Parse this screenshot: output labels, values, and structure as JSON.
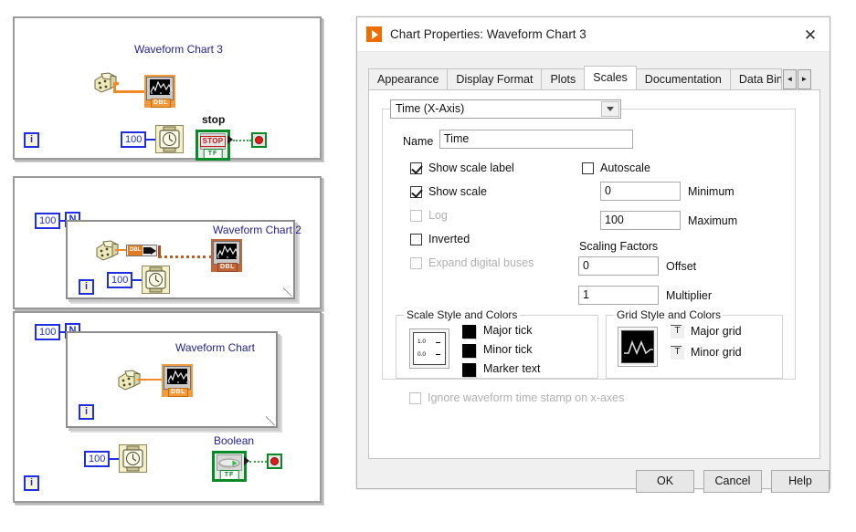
{
  "block_diagrams": {
    "panel1": {
      "chart_title": "Waveform Chart 3",
      "chart_type_label": "DBL",
      "wait_constant": "100",
      "iteration_terminal": "i",
      "stop_label": "stop",
      "stop_button_text": "STOP",
      "bool_tf": "TF"
    },
    "panel2": {
      "loop_count": "100",
      "count_terminal": "N",
      "chart_title": "Waveform Chart 2",
      "chart_type_label": "DBL",
      "wait_constant": "100",
      "iteration_terminal": "i"
    },
    "panel3": {
      "loop_count": "100",
      "count_terminal": "N",
      "chart_title": "Waveform Chart",
      "chart_type_label": "DBL",
      "iteration_terminal_inner": "i",
      "wait_constant": "100",
      "boolean_label": "Boolean",
      "bool_tf": "TF",
      "iteration_terminal_outer": "i"
    }
  },
  "dialog": {
    "title": "Chart Properties: Waveform Chart 3",
    "close_label": "✕",
    "tabs": [
      {
        "label": "Appearance",
        "active": false
      },
      {
        "label": "Display Format",
        "active": false
      },
      {
        "label": "Plots",
        "active": false
      },
      {
        "label": "Scales",
        "active": true
      },
      {
        "label": "Documentation",
        "active": false
      },
      {
        "label": "Data Bin",
        "active": false
      }
    ],
    "tab_nav": {
      "prev": "◄",
      "next": "►"
    },
    "scales": {
      "axis_selector_value": "Time (X-Axis)",
      "name_label": "Name",
      "name_value": "Time",
      "checkboxes": [
        {
          "label": "Show scale label",
          "checked": true,
          "disabled": false
        },
        {
          "label": "Show scale",
          "checked": true,
          "disabled": false
        },
        {
          "label": "Log",
          "checked": false,
          "disabled": true
        },
        {
          "label": "Inverted",
          "checked": false,
          "disabled": false
        },
        {
          "label": "Expand digital buses",
          "checked": false,
          "disabled": true
        }
      ],
      "autoscale_label": "Autoscale",
      "autoscale_checked": false,
      "minimum_label": "Minimum",
      "minimum_value": "0",
      "maximum_label": "Maximum",
      "maximum_value": "100",
      "scaling_factors_label": "Scaling Factors",
      "offset_label": "Offset",
      "offset_value": "0",
      "multiplier_label": "Multiplier",
      "multiplier_value": "1",
      "scale_style_legend": "Scale Style and Colors",
      "scale_preview_top": "1.0",
      "scale_preview_bottom": "0.0",
      "scale_color_items": [
        {
          "label": "Major tick",
          "color": "#000000"
        },
        {
          "label": "Minor tick",
          "color": "#000000"
        },
        {
          "label": "Marker text",
          "color": "#000000"
        }
      ],
      "grid_style_legend": "Grid Style and Colors",
      "grid_items": [
        {
          "label": "Major grid",
          "glyph": "T"
        },
        {
          "label": "Minor grid",
          "glyph": "T"
        }
      ],
      "ignore_timestamp_label": "Ignore waveform time stamp on x-axes",
      "ignore_timestamp_checked": false
    },
    "footer": {
      "ok": "OK",
      "cancel": "Cancel",
      "help": "Help"
    }
  },
  "colors": {
    "brand_orange": "#ef6c00",
    "wire_orange": "#f08a28",
    "wire_blue": "#1f2fdd",
    "green": "#0a8a26",
    "label_blue": "#24228f"
  }
}
